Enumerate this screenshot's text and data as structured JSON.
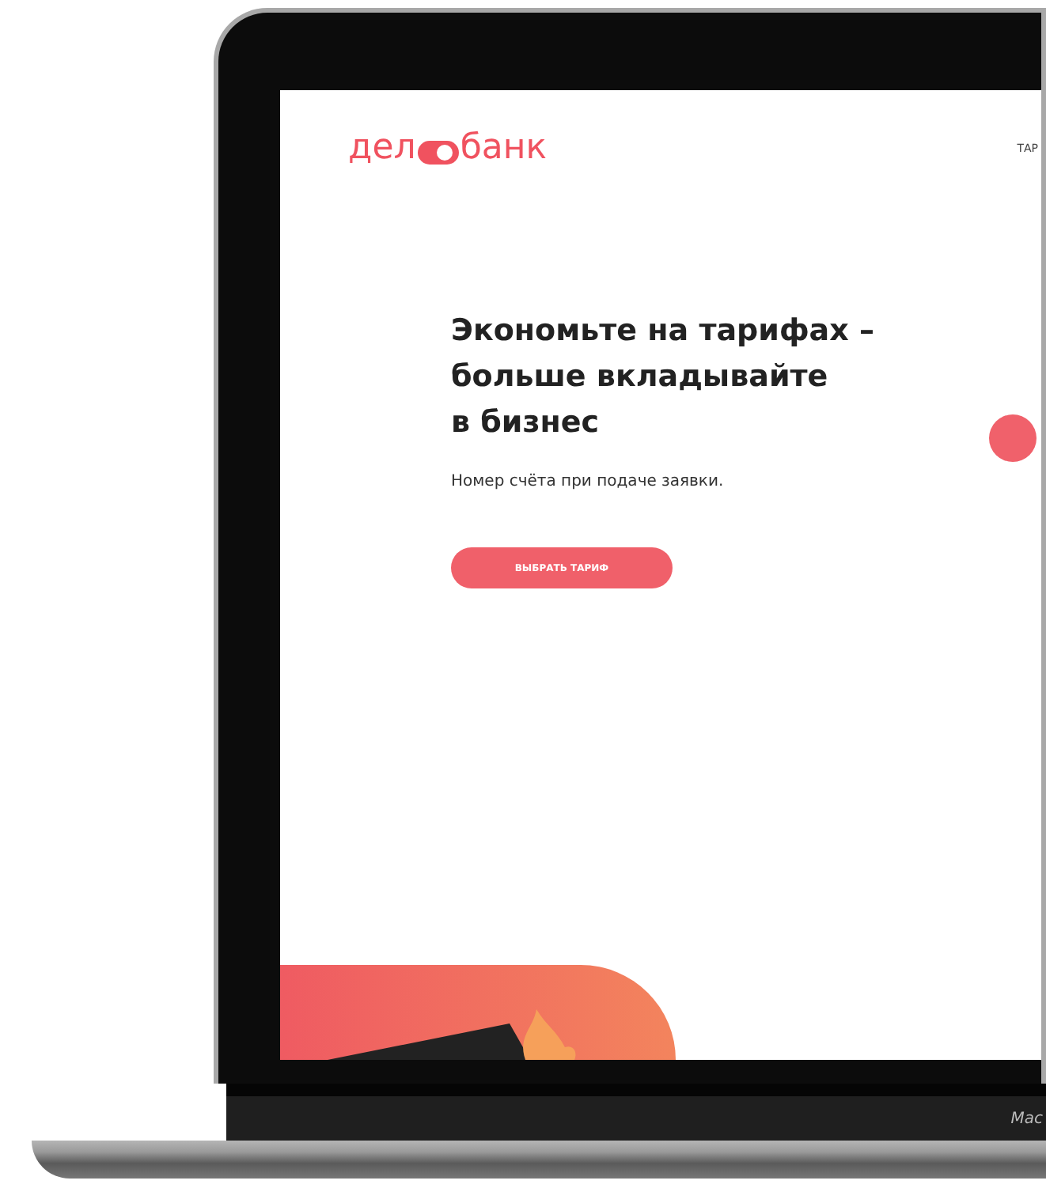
{
  "laptop": {
    "brand_label": "Mac"
  },
  "site": {
    "logo": {
      "before": "дел",
      "after": "банк"
    },
    "nav": {
      "items": [
        "ТАР"
      ]
    },
    "hero": {
      "title_lines": [
        "Экономьте на тарифах –",
        "больше вкладывайте",
        "в бизнес"
      ],
      "subtitle": "Номер счёта при подаче заявки.",
      "button": "ВЫБРАТЬ ТАРИФ"
    }
  }
}
